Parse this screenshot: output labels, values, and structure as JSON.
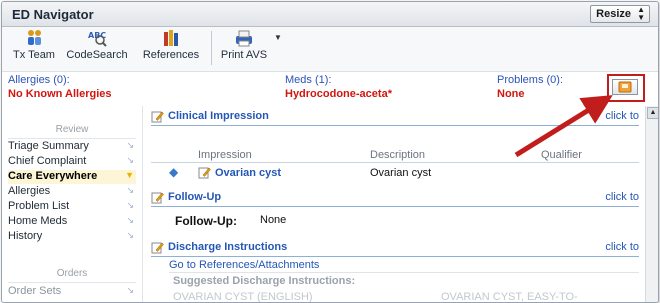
{
  "window": {
    "title": "ED Navigator",
    "resize_label": "Resize"
  },
  "toolbar": {
    "items": [
      {
        "label": "Tx Team",
        "icon": "team-icon"
      },
      {
        "label": "CodeSearch",
        "icon": "code-search-icon"
      },
      {
        "label": "References",
        "icon": "references-icon"
      },
      {
        "label": "Print AVS",
        "icon": "printer-icon"
      }
    ]
  },
  "banner": {
    "allergies_label": "Allergies (0):",
    "allergies_value": "No Known Allergies",
    "meds_label": "Meds (1):",
    "meds_value": "Hydrocodone-aceta*",
    "problems_label": "Problems (0):",
    "problems_value": "None"
  },
  "sidebar": {
    "review_head": "Review",
    "items": [
      {
        "label": "Triage Summary",
        "active": false
      },
      {
        "label": "Chief Complaint",
        "active": false
      },
      {
        "label": "Care Everywhere",
        "active": true
      },
      {
        "label": "Allergies",
        "active": false
      },
      {
        "label": "Problem List",
        "active": false
      },
      {
        "label": "Home Meds",
        "active": false
      },
      {
        "label": "History",
        "active": false
      }
    ],
    "orders_head": "Orders",
    "orders_items": [
      {
        "label": "Order Sets"
      }
    ]
  },
  "clinical_impression": {
    "title": "Clinical Impression",
    "click_to": "click to",
    "col_impression": "Impression",
    "col_description": "Description",
    "col_qualifier": "Qualifier",
    "row_impression": "Ovarian cyst",
    "row_description": "Ovarian cyst"
  },
  "follow_up": {
    "title": "Follow-Up",
    "click_to": "click to",
    "label": "Follow-Up:",
    "value": "None"
  },
  "discharge": {
    "title": "Discharge Instructions",
    "click_to": "click to",
    "link": "Go to References/Attachments",
    "suggested": "Suggested Discharge Instructions:",
    "item_1": "OVARIAN CYST (ENGLISH)",
    "item_2": "OVARIAN CYST, EASY-TO-"
  },
  "colors": {
    "accent": "#2457b5",
    "alert": "#d1160f",
    "highlight": "#c21d1d"
  }
}
